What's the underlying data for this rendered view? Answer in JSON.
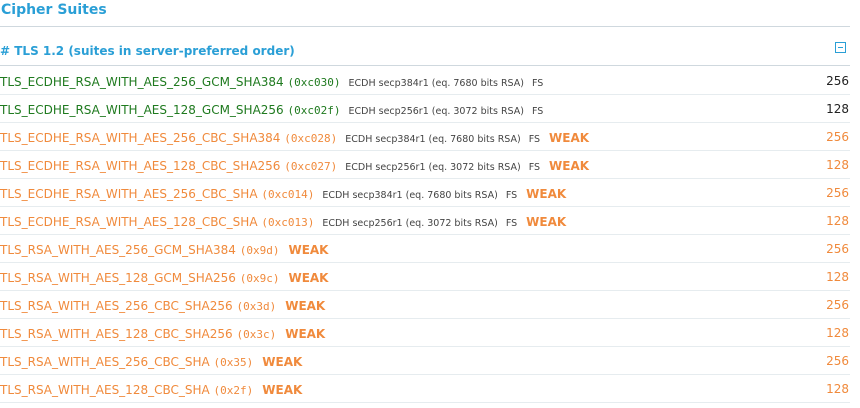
{
  "section_title": "Cipher Suites",
  "tls_header": "# TLS 1.2 (suites in server-preferred order)",
  "suites": [
    {
      "name": "TLS_ECDHE_RSA_WITH_AES_256_GCM_SHA384",
      "code": "(0xc030)",
      "ecdh": "ECDH secp384r1 (eq. 7680 bits RSA)",
      "fs": "FS",
      "weak": "",
      "strength": "256"
    },
    {
      "name": "TLS_ECDHE_RSA_WITH_AES_128_GCM_SHA256",
      "code": "(0xc02f)",
      "ecdh": "ECDH secp256r1 (eq. 3072 bits RSA)",
      "fs": "FS",
      "weak": "",
      "strength": "128"
    },
    {
      "name": "TLS_ECDHE_RSA_WITH_AES_256_CBC_SHA384",
      "code": "(0xc028)",
      "ecdh": "ECDH secp384r1 (eq. 7680 bits RSA)",
      "fs": "FS",
      "weak": "WEAK",
      "strength": "256"
    },
    {
      "name": "TLS_ECDHE_RSA_WITH_AES_128_CBC_SHA256",
      "code": "(0xc027)",
      "ecdh": "ECDH secp256r1 (eq. 3072 bits RSA)",
      "fs": "FS",
      "weak": "WEAK",
      "strength": "128"
    },
    {
      "name": "TLS_ECDHE_RSA_WITH_AES_256_CBC_SHA",
      "code": "(0xc014)",
      "ecdh": "ECDH secp384r1 (eq. 7680 bits RSA)",
      "fs": "FS",
      "weak": "WEAK",
      "strength": "256"
    },
    {
      "name": "TLS_ECDHE_RSA_WITH_AES_128_CBC_SHA",
      "code": "(0xc013)",
      "ecdh": "ECDH secp256r1 (eq. 3072 bits RSA)",
      "fs": "FS",
      "weak": "WEAK",
      "strength": "128"
    },
    {
      "name": "TLS_RSA_WITH_AES_256_GCM_SHA384",
      "code": "(0x9d)",
      "ecdh": "",
      "fs": "",
      "weak": "WEAK",
      "strength": "256"
    },
    {
      "name": "TLS_RSA_WITH_AES_128_GCM_SHA256",
      "code": "(0x9c)",
      "ecdh": "",
      "fs": "",
      "weak": "WEAK",
      "strength": "128"
    },
    {
      "name": "TLS_RSA_WITH_AES_256_CBC_SHA256",
      "code": "(0x3d)",
      "ecdh": "",
      "fs": "",
      "weak": "WEAK",
      "strength": "256"
    },
    {
      "name": "TLS_RSA_WITH_AES_128_CBC_SHA256",
      "code": "(0x3c)",
      "ecdh": "",
      "fs": "",
      "weak": "WEAK",
      "strength": "128"
    },
    {
      "name": "TLS_RSA_WITH_AES_256_CBC_SHA",
      "code": "(0x35)",
      "ecdh": "",
      "fs": "",
      "weak": "WEAK",
      "strength": "256"
    },
    {
      "name": "TLS_RSA_WITH_AES_128_CBC_SHA",
      "code": "(0x2f)",
      "ecdh": "",
      "fs": "",
      "weak": "WEAK",
      "strength": "128"
    }
  ],
  "colors": {
    "accent": "#2a9fd6",
    "ok": "#1f7a1f",
    "weak": "#f08a3c"
  },
  "icons": {
    "collapse": "collapse-icon"
  }
}
